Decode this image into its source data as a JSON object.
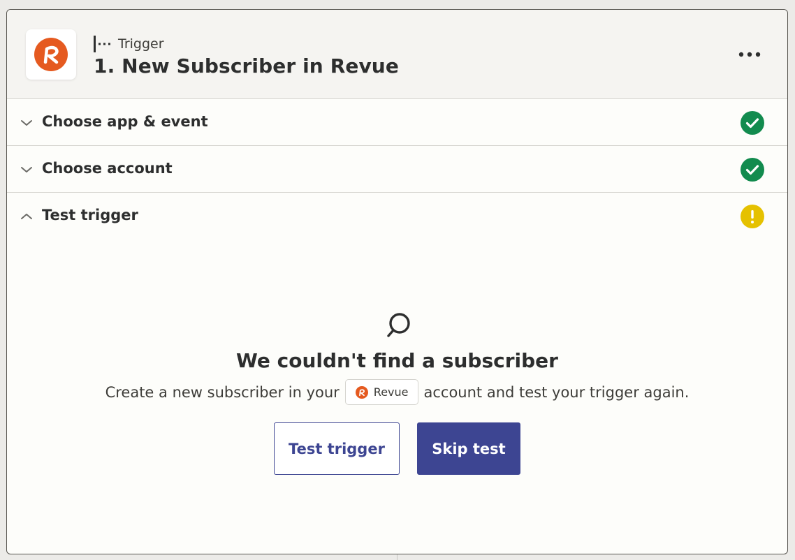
{
  "step": {
    "type_label": "Trigger",
    "title": "1. New Subscriber in Revue",
    "app_logo_letter": "R",
    "more_icon": "ellipsis-icon"
  },
  "sections": [
    {
      "label": "Choose app & event",
      "state": "collapsed",
      "status": "complete"
    },
    {
      "label": "Choose account",
      "state": "collapsed",
      "status": "complete"
    },
    {
      "label": "Test trigger",
      "state": "expanded",
      "status": "warning"
    }
  ],
  "empty_state": {
    "icon": "search-icon",
    "title": "We couldn't find a subscriber",
    "desc_before": "Create a new subscriber in your",
    "app_chip_label": "Revue",
    "desc_after": "account and test your trigger again."
  },
  "actions": {
    "test_label": "Test trigger",
    "skip_label": "Skip test"
  },
  "colors": {
    "brand_revue": "#e55a20",
    "success": "#128b4e",
    "warning": "#e5c100",
    "primary": "#3d4592"
  }
}
